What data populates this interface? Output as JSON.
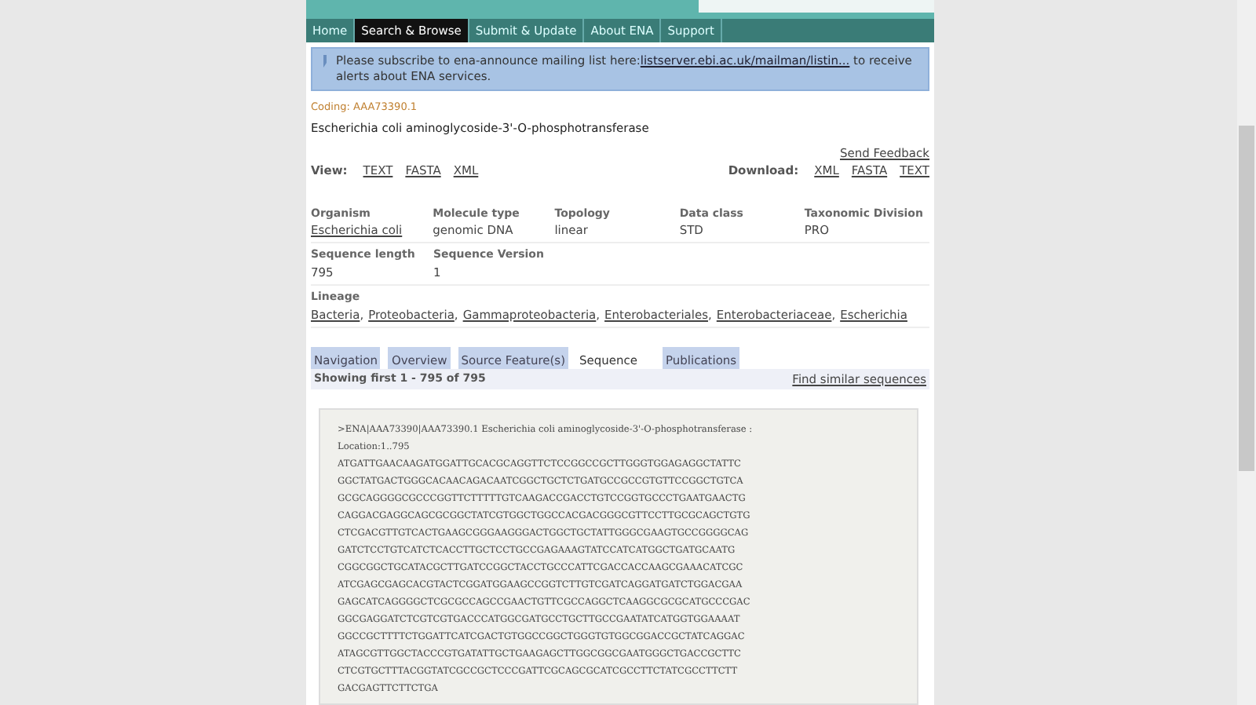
{
  "nav": [
    {
      "label": "Home",
      "selected": false
    },
    {
      "label": "Search & Browse",
      "selected": true
    },
    {
      "label": "Submit & Update",
      "selected": false
    },
    {
      "label": "About ENA",
      "selected": false
    },
    {
      "label": "Support",
      "selected": false
    }
  ],
  "notice": {
    "text": "Please subscribe to ena-announce mailing list here:",
    "link": "listserver.ebi.ac.uk/mailman/listin...",
    "after": "to receive alerts about ENA services."
  },
  "coding": "Coding: AAA73390.1",
  "title": "Escherichia coli aminoglycoside-3'-O-phosphotransferase",
  "feedback": "Send Feedback",
  "view": {
    "label": "View:",
    "links": [
      "TEXT",
      "FASTA",
      "XML"
    ]
  },
  "download": {
    "label": "Download:",
    "links": [
      "XML",
      "FASTA",
      "TEXT"
    ]
  },
  "fields": [
    [
      {
        "label": "Organism",
        "value": "Escherichia coli",
        "link": true
      },
      {
        "label": "Molecule type",
        "value": "genomic DNA",
        "link": false
      },
      {
        "label": "Topology",
        "value": "linear",
        "link": false
      },
      {
        "label": "Data class",
        "value": "STD",
        "link": false
      },
      {
        "label": "Taxonomic Division",
        "value": "PRO",
        "link": false
      }
    ],
    [
      {
        "label": "Sequence length",
        "value": "795",
        "link": false
      },
      {
        "label": "Sequence Version",
        "value": "1",
        "link": false
      }
    ]
  ],
  "lineage": {
    "label": "Lineage",
    "separator": ",",
    "items": [
      "Bacteria",
      "Proteobacteria",
      "Gammaproteobacteria",
      "Enterobacteriales",
      "Enterobacteriaceae",
      "Escherichia"
    ]
  },
  "tabs": [
    {
      "label": "Navigation",
      "selected": false
    },
    {
      "label": "Overview",
      "selected": false
    },
    {
      "label": "Source Feature(s)",
      "selected": false
    },
    {
      "label": "Sequence",
      "selected": true
    },
    {
      "label": "Publications",
      "selected": false
    }
  ],
  "showing": "Showing first 1 - 795 of 795",
  "similar": "Find similar sequences",
  "sequence": {
    "header": ">ENA|AAA73390|AAA73390.1 Escherichia coli aminoglycoside-3'-O-phosphotransferase :",
    "location": "Location:1..795",
    "lines": [
      "ATGATTGAACAAGATGGATTGCACGCAGGTTCTCCGGCCGCTTGGGTGGAGAGGCTATTC",
      "GGCTATGACTGGGCACAACAGACAATCGGCTGCTCTGATGCCGCCGTGTTCCGGCTGTCA",
      "GCGCAGGGGCGCCCGGTTCTTTTTGTCAAGACCGACCTGTCCGGTGCCCTGAATGAACTG",
      "CAGGACGAGGCAGCGCGGCTATCGTGGCTGGCCACGACGGGCGTTCCTTGCGCAGCTGTG",
      "CTCGACGTTGTCACTGAAGCGGGAAGGGACTGGCTGCTATTGGGCGAAGTGCCGGGGCAG",
      "GATCTCCTGTCATCTCACCTTGCTCCTGCCGAGAAAGTATCCATCATGGCTGATGCAATG",
      "CGGCGGCTGCATACGCTTGATCCGGCTACCTGCCCATTCGACCACCAAGCGAAACATCGC",
      "ATCGAGCGAGCACGTACTCGGATGGAAGCCGGTCTTGTCGATCAGGATGATCTGGACGAA",
      "GAGCATCAGGGGCTCGCGCCAGCCGAACTGTTCGCCAGGCTCAAGGCGCGCATGCCCGAC",
      "GGCGAGGATCTCGTCGTGACCCATGGCGATGCCTGCTTGCCGAATATCATGGTGGAAAAT",
      "GGCCGCTTTTCTGGATTCATCGACTGTGGCCGGCTGGGTGTGGCGGACCGCTATCAGGAC",
      "ATAGCGTTGGCTACCCGTGATATTGCTGAAGAGCTTGGCGGCGAATGGGCTGACCGCTTC",
      "CTCGTGCTTTACGGTATCGCCGCTCCCGATTCGCAGCGCATCGCCTTCTATCGCCTTCTT",
      "GACGAGTTCTTCTGA"
    ]
  }
}
